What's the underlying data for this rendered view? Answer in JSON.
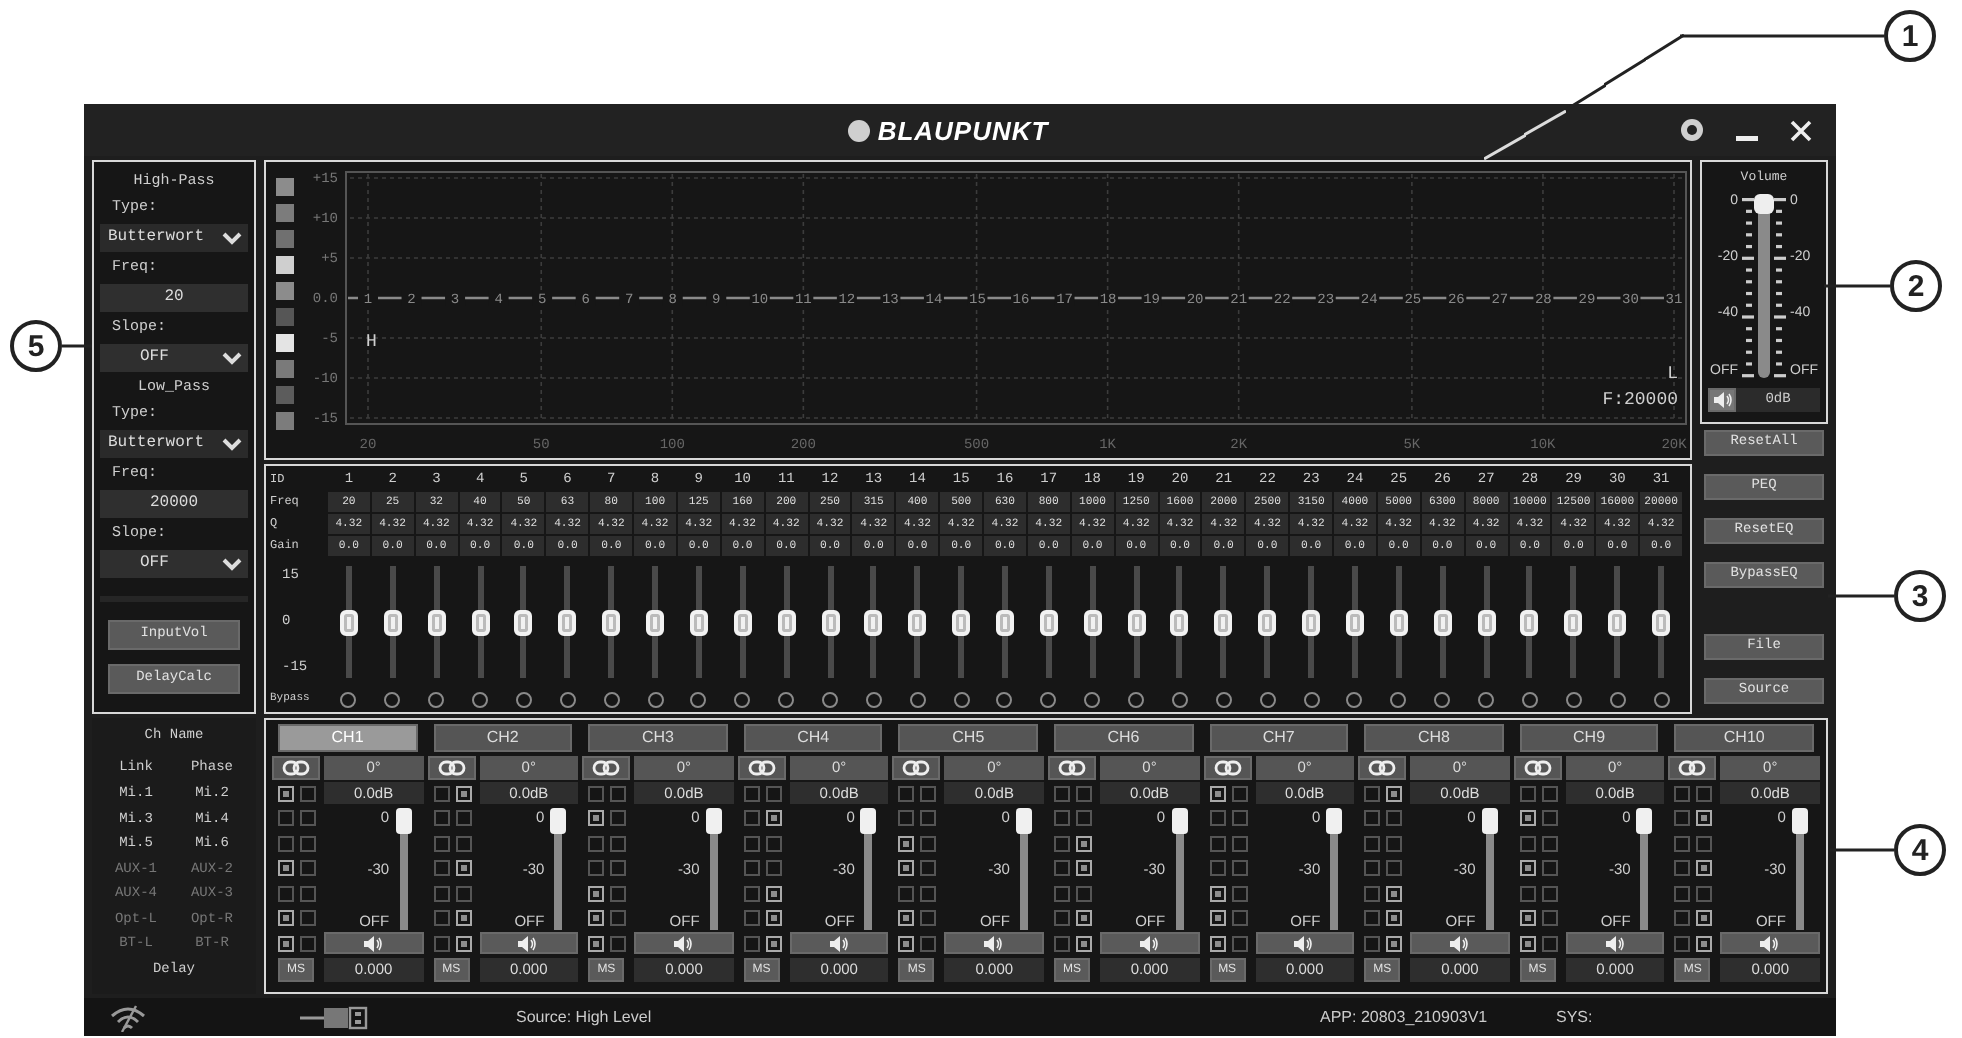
{
  "title_bar": {
    "brand": "BLAUPUNKT"
  },
  "filters": {
    "high_pass": {
      "title": "High-Pass",
      "type_label": "Type:",
      "type": "Butterwort",
      "freq_label": "Freq:",
      "freq": "20",
      "slope_label": "Slope:",
      "slope": "OFF"
    },
    "low_pass": {
      "title": "Low_Pass",
      "type_label": "Type:",
      "type": "Butterwort",
      "freq_label": "Freq:",
      "freq": "20000",
      "slope_label": "Slope:",
      "slope": "OFF"
    },
    "buttons": [
      "InputVol",
      "DelayCalc"
    ]
  },
  "graph": {
    "swatches": [
      {
        "color": "#8c8c8c"
      },
      {
        "color": "#7c7c7c"
      },
      {
        "color": "#707070"
      },
      {
        "color": "#cfcfcf"
      },
      {
        "color": "#8c8c8c"
      },
      {
        "color": "#565656"
      },
      {
        "color": "#e4e4e4"
      },
      {
        "color": "#7a7a7a"
      },
      {
        "color": "#5c5c5c"
      },
      {
        "color": "#7c7c7c"
      }
    ],
    "y_labels": [
      "+15",
      "+10",
      "+5",
      "0.0",
      "-5",
      "-10",
      "-15"
    ],
    "x_labels": [
      "20",
      "50",
      "100",
      "200",
      "500",
      "1K",
      "2K",
      "5K",
      "10K",
      "20K"
    ],
    "point_labels": [
      "1",
      "2",
      "3",
      "4",
      "5",
      "6",
      "7",
      "8",
      "9",
      "10",
      "11",
      "12",
      "13",
      "14",
      "15",
      "16",
      "17",
      "18",
      "19",
      "20",
      "21",
      "22",
      "23",
      "24",
      "25",
      "26",
      "27",
      "28",
      "29",
      "30",
      "31"
    ],
    "high_marker": "H",
    "low_marker": "L",
    "frequency": "F:20000"
  },
  "volume": {
    "title": "Volume",
    "left_scale": [
      "0",
      "-20",
      "-40",
      "OFF"
    ],
    "right_scale": [
      "0",
      "-20",
      "-40",
      "OFF"
    ],
    "level": 1,
    "reading": "0dB"
  },
  "side_buttons": [
    "ResetAll",
    "PEQ",
    "ResetEQ",
    "BypassEQ",
    "File",
    "Source"
  ],
  "eq": {
    "row_labels": [
      "ID",
      "Freq",
      "Q",
      "Gain"
    ],
    "scale": [
      "15",
      "0",
      "-15"
    ],
    "bypass_label": "Bypass",
    "bands": [
      {
        "number": "1",
        "freq": "20",
        "q": "4.32",
        "gain": "0.0",
        "level": 0.5,
        "bypass": false
      },
      {
        "number": "2",
        "freq": "25",
        "q": "4.32",
        "gain": "0.0",
        "level": 0.5,
        "bypass": false
      },
      {
        "number": "3",
        "freq": "32",
        "q": "4.32",
        "gain": "0.0",
        "level": 0.5,
        "bypass": false
      },
      {
        "number": "4",
        "freq": "40",
        "q": "4.32",
        "gain": "0.0",
        "level": 0.5,
        "bypass": false
      },
      {
        "number": "5",
        "freq": "50",
        "q": "4.32",
        "gain": "0.0",
        "level": 0.5,
        "bypass": false
      },
      {
        "number": "6",
        "freq": "63",
        "q": "4.32",
        "gain": "0.0",
        "level": 0.5,
        "bypass": false
      },
      {
        "number": "7",
        "freq": "80",
        "q": "4.32",
        "gain": "0.0",
        "level": 0.5,
        "bypass": false
      },
      {
        "number": "8",
        "freq": "100",
        "q": "4.32",
        "gain": "0.0",
        "level": 0.5,
        "bypass": false
      },
      {
        "number": "9",
        "freq": "125",
        "q": "4.32",
        "gain": "0.0",
        "level": 0.5,
        "bypass": false
      },
      {
        "number": "10",
        "freq": "160",
        "q": "4.32",
        "gain": "0.0",
        "level": 0.5,
        "bypass": false
      },
      {
        "number": "11",
        "freq": "200",
        "q": "4.32",
        "gain": "0.0",
        "level": 0.5,
        "bypass": false
      },
      {
        "number": "12",
        "freq": "250",
        "q": "4.32",
        "gain": "0.0",
        "level": 0.5,
        "bypass": false
      },
      {
        "number": "13",
        "freq": "315",
        "q": "4.32",
        "gain": "0.0",
        "level": 0.5,
        "bypass": false
      },
      {
        "number": "14",
        "freq": "400",
        "q": "4.32",
        "gain": "0.0",
        "level": 0.5,
        "bypass": false
      },
      {
        "number": "15",
        "freq": "500",
        "q": "4.32",
        "gain": "0.0",
        "level": 0.5,
        "bypass": false
      },
      {
        "number": "16",
        "freq": "630",
        "q": "4.32",
        "gain": "0.0",
        "level": 0.5,
        "bypass": false
      },
      {
        "number": "17",
        "freq": "800",
        "q": "4.32",
        "gain": "0.0",
        "level": 0.5,
        "bypass": false
      },
      {
        "number": "18",
        "freq": "1000",
        "q": "4.32",
        "gain": "0.0",
        "level": 0.5,
        "bypass": false
      },
      {
        "number": "19",
        "freq": "1250",
        "q": "4.32",
        "gain": "0.0",
        "level": 0.5,
        "bypass": false
      },
      {
        "number": "20",
        "freq": "1600",
        "q": "4.32",
        "gain": "0.0",
        "level": 0.5,
        "bypass": false
      },
      {
        "number": "21",
        "freq": "2000",
        "q": "4.32",
        "gain": "0.0",
        "level": 0.5,
        "bypass": false
      },
      {
        "number": "22",
        "freq": "2500",
        "q": "4.32",
        "gain": "0.0",
        "level": 0.5,
        "bypass": false
      },
      {
        "number": "23",
        "freq": "3150",
        "q": "4.32",
        "gain": "0.0",
        "level": 0.5,
        "bypass": false
      },
      {
        "number": "24",
        "freq": "4000",
        "q": "4.32",
        "gain": "0.0",
        "level": 0.5,
        "bypass": false
      },
      {
        "number": "25",
        "freq": "5000",
        "q": "4.32",
        "gain": "0.0",
        "level": 0.5,
        "bypass": false
      },
      {
        "number": "26",
        "freq": "6300",
        "q": "4.32",
        "gain": "0.0",
        "level": 0.5,
        "bypass": false
      },
      {
        "number": "27",
        "freq": "8000",
        "q": "4.32",
        "gain": "0.0",
        "level": 0.5,
        "bypass": false
      },
      {
        "number": "28",
        "freq": "10000",
        "q": "4.32",
        "gain": "0.0",
        "level": 0.5,
        "bypass": false
      },
      {
        "number": "29",
        "freq": "12500",
        "q": "4.32",
        "gain": "0.0",
        "level": 0.5,
        "bypass": false
      },
      {
        "number": "30",
        "freq": "16000",
        "q": "4.32",
        "gain": "0.0",
        "level": 0.5,
        "bypass": false
      },
      {
        "number": "31",
        "freq": "20000",
        "q": "4.32",
        "gain": "0.0",
        "level": 0.5,
        "bypass": false
      }
    ]
  },
  "inputs": {
    "title": "Ch Name",
    "columns": [
      "Link",
      "Phase"
    ],
    "footer": "Delay",
    "rows": [
      {
        "left": "Mi.1",
        "right": "Mi.2",
        "disabled": false
      },
      {
        "left": "Mi.3",
        "right": "Mi.4",
        "disabled": false
      },
      {
        "left": "Mi.5",
        "right": "Mi.6",
        "disabled": false
      },
      {
        "left": "AUX-1",
        "right": "AUX-2",
        "disabled": true
      },
      {
        "left": "AUX-4",
        "right": "AUX-3",
        "disabled": true
      },
      {
        "left": "Opt-L",
        "right": "Opt-R",
        "disabled": true
      },
      {
        "left": "BT-L",
        "right": "BT-R",
        "disabled": true
      }
    ]
  },
  "channels": [
    {
      "name": "CH1",
      "selected": true,
      "phase": "0°",
      "gain": "0.0dB",
      "scale": [
        "0",
        "-30",
        "OFF"
      ],
      "level": 1,
      "ms": "MS",
      "delay": "0.000",
      "routing": [
        [
          true,
          false
        ],
        [
          false,
          false
        ],
        [
          false,
          false
        ],
        [
          true,
          false
        ],
        [
          false,
          false
        ],
        [
          true,
          false
        ],
        [
          true,
          false
        ]
      ]
    },
    {
      "name": "CH2",
      "selected": false,
      "phase": "0°",
      "gain": "0.0dB",
      "scale": [
        "0",
        "-30",
        "OFF"
      ],
      "level": 1,
      "ms": "MS",
      "delay": "0.000",
      "routing": [
        [
          false,
          true
        ],
        [
          false,
          false
        ],
        [
          false,
          false
        ],
        [
          false,
          true
        ],
        [
          false,
          false
        ],
        [
          false,
          true
        ],
        [
          false,
          true
        ]
      ]
    },
    {
      "name": "CH3",
      "selected": false,
      "phase": "0°",
      "gain": "0.0dB",
      "scale": [
        "0",
        "-30",
        "OFF"
      ],
      "level": 1,
      "ms": "MS",
      "delay": "0.000",
      "routing": [
        [
          false,
          false
        ],
        [
          true,
          false
        ],
        [
          false,
          false
        ],
        [
          false,
          false
        ],
        [
          true,
          false
        ],
        [
          true,
          false
        ],
        [
          true,
          false
        ]
      ]
    },
    {
      "name": "CH4",
      "selected": false,
      "phase": "0°",
      "gain": "0.0dB",
      "scale": [
        "0",
        "-30",
        "OFF"
      ],
      "level": 1,
      "ms": "MS",
      "delay": "0.000",
      "routing": [
        [
          false,
          false
        ],
        [
          false,
          true
        ],
        [
          false,
          false
        ],
        [
          false,
          false
        ],
        [
          false,
          true
        ],
        [
          false,
          true
        ],
        [
          false,
          true
        ]
      ]
    },
    {
      "name": "CH5",
      "selected": false,
      "phase": "0°",
      "gain": "0.0dB",
      "scale": [
        "0",
        "-30",
        "OFF"
      ],
      "level": 1,
      "ms": "MS",
      "delay": "0.000",
      "routing": [
        [
          false,
          false
        ],
        [
          false,
          false
        ],
        [
          true,
          false
        ],
        [
          true,
          false
        ],
        [
          false,
          false
        ],
        [
          true,
          false
        ],
        [
          true,
          false
        ]
      ]
    },
    {
      "name": "CH6",
      "selected": false,
      "phase": "0°",
      "gain": "0.0dB",
      "scale": [
        "0",
        "-30",
        "OFF"
      ],
      "level": 1,
      "ms": "MS",
      "delay": "0.000",
      "routing": [
        [
          false,
          false
        ],
        [
          false,
          false
        ],
        [
          false,
          true
        ],
        [
          false,
          true
        ],
        [
          false,
          false
        ],
        [
          false,
          true
        ],
        [
          false,
          true
        ]
      ]
    },
    {
      "name": "CH7",
      "selected": false,
      "phase": "0°",
      "gain": "0.0dB",
      "scale": [
        "0",
        "-30",
        "OFF"
      ],
      "level": 1,
      "ms": "MS",
      "delay": "0.000",
      "routing": [
        [
          true,
          false
        ],
        [
          false,
          false
        ],
        [
          false,
          false
        ],
        [
          false,
          false
        ],
        [
          true,
          false
        ],
        [
          true,
          false
        ],
        [
          true,
          false
        ]
      ]
    },
    {
      "name": "CH8",
      "selected": false,
      "phase": "0°",
      "gain": "0.0dB",
      "scale": [
        "0",
        "-30",
        "OFF"
      ],
      "level": 1,
      "ms": "MS",
      "delay": "0.000",
      "routing": [
        [
          false,
          true
        ],
        [
          false,
          false
        ],
        [
          false,
          false
        ],
        [
          false,
          false
        ],
        [
          false,
          true
        ],
        [
          false,
          true
        ],
        [
          false,
          true
        ]
      ]
    },
    {
      "name": "CH9",
      "selected": false,
      "phase": "0°",
      "gain": "0.0dB",
      "scale": [
        "0",
        "-30",
        "OFF"
      ],
      "level": 1,
      "ms": "MS",
      "delay": "0.000",
      "routing": [
        [
          false,
          false
        ],
        [
          true,
          false
        ],
        [
          false,
          false
        ],
        [
          true,
          false
        ],
        [
          false,
          false
        ],
        [
          true,
          false
        ],
        [
          true,
          false
        ]
      ]
    },
    {
      "name": "CH10",
      "selected": false,
      "phase": "0°",
      "gain": "0.0dB",
      "scale": [
        "0",
        "-30",
        "OFF"
      ],
      "level": 1,
      "ms": "MS",
      "delay": "0.000",
      "routing": [
        [
          false,
          false
        ],
        [
          false,
          true
        ],
        [
          false,
          false
        ],
        [
          false,
          true
        ],
        [
          false,
          false
        ],
        [
          false,
          true
        ],
        [
          false,
          true
        ]
      ]
    }
  ],
  "status_bar": {
    "source": "Source: High Level",
    "app": "APP: 20803_210903V1",
    "sys": "SYS:"
  },
  "callouts": [
    "1",
    "2",
    "3",
    "4",
    "5"
  ]
}
